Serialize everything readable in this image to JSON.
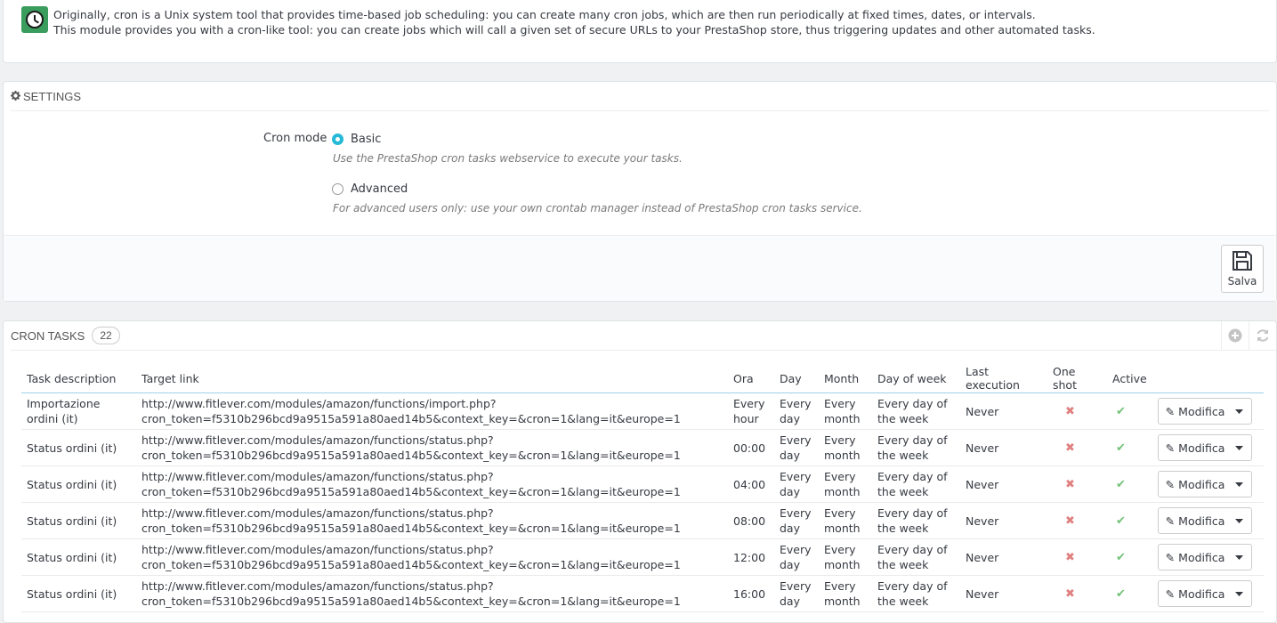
{
  "info": {
    "line1": "Originally, cron is a Unix system tool that provides time-based job scheduling: you can create many cron jobs, which are then run periodically at fixed times, dates, or intervals.",
    "line2": "This module provides you with a cron-like tool: you can create jobs which will call a given set of secure URLs to your PrestaShop store, thus triggering updates and other automated tasks."
  },
  "settings": {
    "heading": "SETTINGS",
    "cron_mode_label": "Cron mode",
    "basic_label": "Basic",
    "basic_help": "Use the PrestaShop cron tasks webservice to execute your tasks.",
    "advanced_label": "Advanced",
    "advanced_help": "For advanced users only: use your own crontab manager instead of PrestaShop cron tasks service.",
    "selected": "Basic",
    "save_label": "Salva"
  },
  "tasks": {
    "heading": "CRON TASKS",
    "count": "22",
    "columns": [
      "Task description",
      "Target link",
      "Ora",
      "Day",
      "Month",
      "Day of week",
      "Last execution",
      "One shot",
      "Active"
    ],
    "rows": [
      {
        "desc": "Importazione ordini (it)",
        "link1": "http://www.fitlever.com/modules/amazon/functions/import.php?",
        "link2": "cron_token=f5310b296bcd9a9515a591a80aed14b5&context_key=&cron=1&lang=it&europe=1",
        "ora": "Every hour",
        "day": "Every day",
        "month": "Every month",
        "dow": "Every day of the week",
        "last": "Never",
        "action": "Modifica"
      },
      {
        "desc": "Status ordini (it)",
        "link1": "http://www.fitlever.com/modules/amazon/functions/status.php?",
        "link2": "cron_token=f5310b296bcd9a9515a591a80aed14b5&context_key=&cron=1&lang=it&europe=1",
        "ora": "00:00",
        "day": "Every day",
        "month": "Every month",
        "dow": "Every day of the week",
        "last": "Never",
        "action": "Modifica"
      },
      {
        "desc": "Status ordini (it)",
        "link1": "http://www.fitlever.com/modules/amazon/functions/status.php?",
        "link2": "cron_token=f5310b296bcd9a9515a591a80aed14b5&context_key=&cron=1&lang=it&europe=1",
        "ora": "04:00",
        "day": "Every day",
        "month": "Every month",
        "dow": "Every day of the week",
        "last": "Never",
        "action": "Modifica"
      },
      {
        "desc": "Status ordini (it)",
        "link1": "http://www.fitlever.com/modules/amazon/functions/status.php?",
        "link2": "cron_token=f5310b296bcd9a9515a591a80aed14b5&context_key=&cron=1&lang=it&europe=1",
        "ora": "08:00",
        "day": "Every day",
        "month": "Every month",
        "dow": "Every day of the week",
        "last": "Never",
        "action": "Modifica"
      },
      {
        "desc": "Status ordini (it)",
        "link1": "http://www.fitlever.com/modules/amazon/functions/status.php?",
        "link2": "cron_token=f5310b296bcd9a9515a591a80aed14b5&context_key=&cron=1&lang=it&europe=1",
        "ora": "12:00",
        "day": "Every day",
        "month": "Every month",
        "dow": "Every day of the week",
        "last": "Never",
        "action": "Modifica"
      },
      {
        "desc": "Status ordini (it)",
        "link1": "http://www.fitlever.com/modules/amazon/functions/status.php?",
        "link2": "cron_token=f5310b296bcd9a9515a591a80aed14b5&context_key=&cron=1&lang=it&europe=1",
        "ora": "16:00",
        "day": "Every day",
        "month": "Every month",
        "dow": "Every day of the week",
        "last": "Never",
        "action": "Modifica"
      }
    ]
  },
  "icons": {
    "clock": "clock-icon",
    "gear": "gear-icon",
    "save": "floppy-disk-icon",
    "add": "plus-circle-icon",
    "refresh": "refresh-icon",
    "one_shot": "cross-icon",
    "active": "check-icon",
    "edit": "pencil-icon",
    "caret": "caret-down-icon"
  },
  "colors": {
    "accent": "#25b9d7",
    "success": "#72c279",
    "danger": "#e08080",
    "clock_bg": "#3a9d5d"
  }
}
